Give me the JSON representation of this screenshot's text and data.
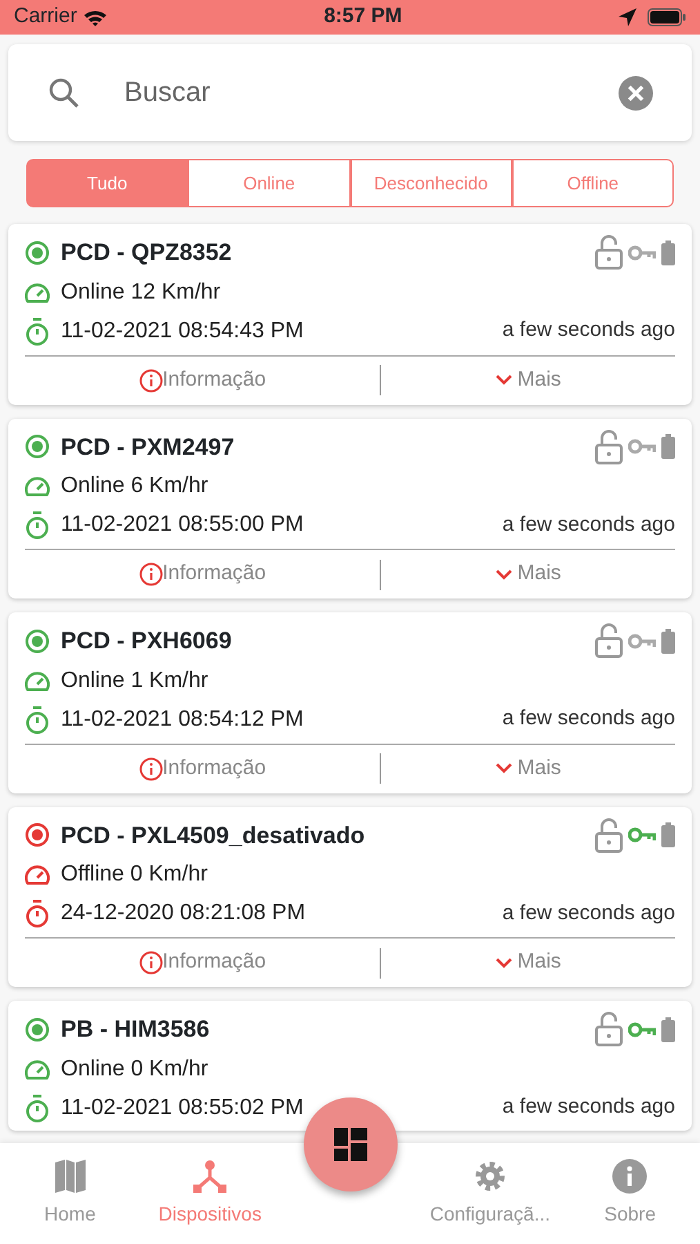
{
  "status_bar": {
    "carrier": "Carrier",
    "time": "8:57 PM"
  },
  "search": {
    "placeholder": "Buscar"
  },
  "filters": [
    {
      "label": "Tudo",
      "selected": true
    },
    {
      "label": "Online",
      "selected": false
    },
    {
      "label": "Desconhecido",
      "selected": false
    },
    {
      "label": "Offline",
      "selected": false
    }
  ],
  "devices": [
    {
      "name": "PCD - QPZ8352",
      "color": "#4caf50",
      "speed": "Online 12 Km/hr",
      "timestamp": "11-02-2021 08:54:43 PM",
      "ago": "a few seconds ago",
      "key_on": false,
      "info": "Informação",
      "more": "Mais"
    },
    {
      "name": "PCD - PXM2497",
      "color": "#4caf50",
      "speed": "Online 6 Km/hr",
      "timestamp": "11-02-2021 08:55:00 PM",
      "ago": "a few seconds ago",
      "key_on": false,
      "info": "Informação",
      "more": "Mais"
    },
    {
      "name": "PCD - PXH6069",
      "color": "#4caf50",
      "speed": "Online 1 Km/hr",
      "timestamp": "11-02-2021 08:54:12 PM",
      "ago": "a few seconds ago",
      "key_on": false,
      "info": "Informação",
      "more": "Mais"
    },
    {
      "name": "PCD - PXL4509_desativado",
      "color": "#e53935",
      "speed": "Offline 0 Km/hr",
      "timestamp": "24-12-2020 08:21:08 PM",
      "ago": "a few seconds ago",
      "key_on": true,
      "info": "Informação",
      "more": "Mais"
    },
    {
      "name": "PB - HIM3586",
      "color": "#4caf50",
      "speed": "Online 0 Km/hr",
      "timestamp": "11-02-2021 08:55:02 PM",
      "ago": "a few seconds ago",
      "key_on": true
    }
  ],
  "tab_bar": [
    {
      "kind": "map",
      "label": "Home",
      "selected": false
    },
    {
      "kind": "devices",
      "label": "Dispositivos",
      "selected": true
    },
    {
      "kind": "gear",
      "label": "Configuraçã...",
      "selected": false
    },
    {
      "kind": "info",
      "label": "Sobre",
      "selected": false
    }
  ]
}
